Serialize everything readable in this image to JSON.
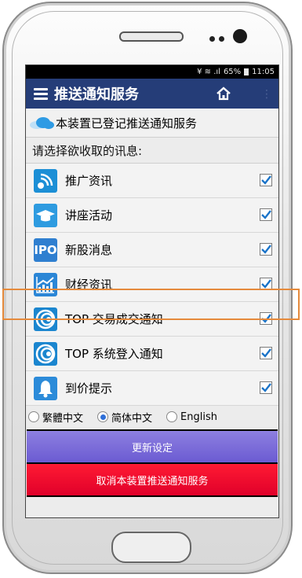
{
  "status_bar": {
    "signal": "¥ ≋ .ıl",
    "battery": "65%",
    "time": "11:05"
  },
  "app_bar": {
    "title": "推送通知服务",
    "menu_icon": "menu-icon",
    "home_icon": "home-icon",
    "overflow": "⋮"
  },
  "registered_text": "本装置已登记推送通知服务",
  "choose_label": "请选择欲收取的讯息:",
  "items": [
    {
      "label": "推广资讯",
      "icon": "broadcast-icon",
      "color": "#1c8fd6",
      "checked": true
    },
    {
      "label": "讲座活动",
      "icon": "graduation-cap-icon",
      "color": "#2e9be0",
      "checked": true
    },
    {
      "label": "新股消息",
      "icon": "ipo-icon",
      "icon_text": "IPO",
      "color": "#2f7fd0",
      "checked": true
    },
    {
      "label": "财经资讯",
      "icon": "chart-icon",
      "color": "#2b86d6",
      "checked": true
    },
    {
      "label": "TOP 交易成交通知",
      "icon": "top-logo-icon",
      "color": "#1b86cf",
      "checked": true
    },
    {
      "label": "TOP 系统登入通知",
      "icon": "top-logo-icon",
      "color": "#1b86cf",
      "checked": true
    },
    {
      "label": "到价提示",
      "icon": "bell-icon",
      "color": "#2c8bd9",
      "checked": true
    }
  ],
  "languages": {
    "options": [
      "繁體中文",
      "简体中文",
      "English"
    ],
    "selected": "简体中文"
  },
  "buttons": {
    "update": "更新设定",
    "cancel": "取消本装置推送通知服务"
  },
  "colors": {
    "app_bar": "#253d78",
    "update_button": "#7a6cd9",
    "cancel_button": "#f0112e",
    "highlight": "#e58a3c"
  }
}
